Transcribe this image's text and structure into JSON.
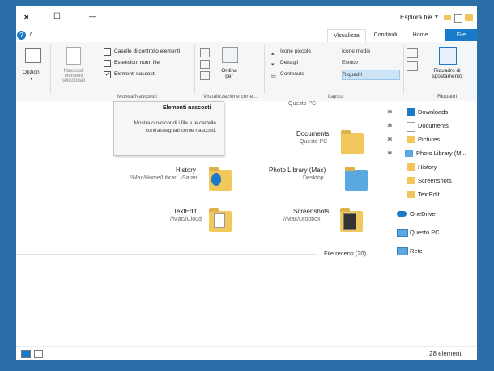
{
  "window": {
    "title": "Esplora file"
  },
  "titlebar": {
    "close_glyph": "✕",
    "maximize_glyph": "☐",
    "minimize_glyph": "—"
  },
  "tabs": {
    "file": "File",
    "home": "Home",
    "condividi": "Condividi",
    "visualizza": "Visualizza"
  },
  "ribbon": {
    "options": {
      "label": "Opzioni"
    },
    "show_hide": {
      "group_label": "Mostra/Nascondi",
      "hide_selected": "Nascondi elementi selezionati",
      "checkboxes": [
        {
          "label": "Caselle di controllo elementi",
          "checked": false
        },
        {
          "label": "Estensioni nomi file",
          "checked": false
        },
        {
          "label": "Elementi nascosti",
          "checked": true
        }
      ]
    },
    "current_view": {
      "group_label": "Visualizzazione corre...",
      "sort_label": "Ordina per"
    },
    "layout": {
      "group_label": "Layout",
      "items": [
        {
          "label": "Icone medie"
        },
        {
          "label": "Icone piccole"
        },
        {
          "label": "Elenco"
        },
        {
          "label": "Dettagli"
        },
        {
          "label": "Riquadri",
          "selected": true
        },
        {
          "label": "Contenuto"
        }
      ]
    },
    "panes": {
      "group_label": "Riquadri",
      "preview_pane": "Riquadro di spostamento"
    }
  },
  "tooltip": {
    "title": "Elementi nascosti",
    "body": "Mostra o nascondi i file e le cartelle contrassegnati come nascosti."
  },
  "grid": [
    {
      "name": "Documents",
      "location": "Questo PC"
    },
    {
      "name": "History",
      "location": "//Mac/Home/Librar...\\Safari"
    },
    {
      "name": "Photo Library (Mac)",
      "location": "Desktop"
    },
    {
      "name": "TextEdit",
      "location": "//Mac/iCloud"
    },
    {
      "name": "Screenshots",
      "location": "//Mac/Dropbox"
    }
  ],
  "grid_top_partial": "Questo PC",
  "recent_files": "File recenti (20)",
  "nav": {
    "items": [
      {
        "label": "Downloads",
        "pinned": true
      },
      {
        "label": "Documents",
        "pinned": true
      },
      {
        "label": "Pictures",
        "pinned": true
      },
      {
        "label": "Photo Library (M...",
        "pinned": true
      },
      {
        "label": "History",
        "pinned": false
      },
      {
        "label": "Screenshots",
        "pinned": false
      },
      {
        "label": "TextEdit",
        "pinned": false
      },
      {
        "label": "OneDrive",
        "pinned": false
      },
      {
        "label": "Questo PC",
        "pinned": false
      },
      {
        "label": "Rete",
        "pinned": false
      }
    ]
  },
  "status": {
    "count": "28 elementi"
  },
  "colors": {
    "accent": "#1979ca",
    "selection": "#cde4f7",
    "folder": "#f2c65a",
    "background": "#2a6fa8"
  }
}
